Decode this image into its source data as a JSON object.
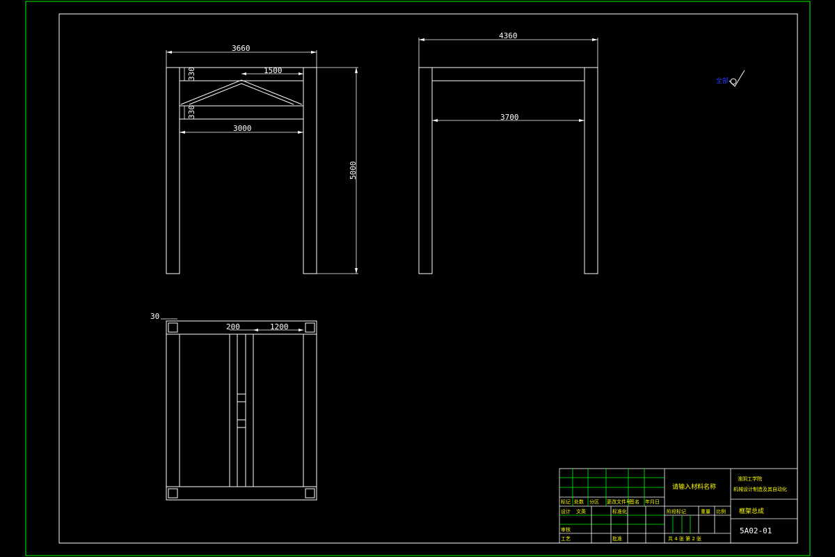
{
  "colors": {
    "background": "#000000",
    "border": "#00ff00",
    "line": "#ffffff",
    "title_text": "#ffff00",
    "note_text": "#2d3cff"
  },
  "front_view": {
    "dim_total_width": "3660",
    "dim_top_offset": "330",
    "dim_apex_half": "1500",
    "dim_mid_offset": "330",
    "dim_inner_width": "3000",
    "dim_height": "5000"
  },
  "side_view": {
    "dim_total_width": "4360",
    "dim_inner_width": "3700"
  },
  "top_view": {
    "dim_corner": "30",
    "dim_center": "200",
    "dim_offset": "1200"
  },
  "surface_note": "全部",
  "title_block": {
    "material_placeholder": "请输入材料名称",
    "school": "淮阴工学院",
    "project": "机械设计制造及其自动化",
    "drawing_name": "框架总成",
    "drawing_number": "5A02-01",
    "sheet_info": "共 4 张 第 2 张",
    "row_labels": [
      "标记",
      "设计",
      "审核",
      "工艺"
    ],
    "header_labels": [
      "处数",
      "分区",
      "更改文件号",
      "签名",
      "年月日"
    ],
    "col_labels": [
      "标准化",
      "批准"
    ],
    "stage_labels": [
      "阶段标记",
      "重量",
      "比例"
    ],
    "designer": "文英"
  }
}
